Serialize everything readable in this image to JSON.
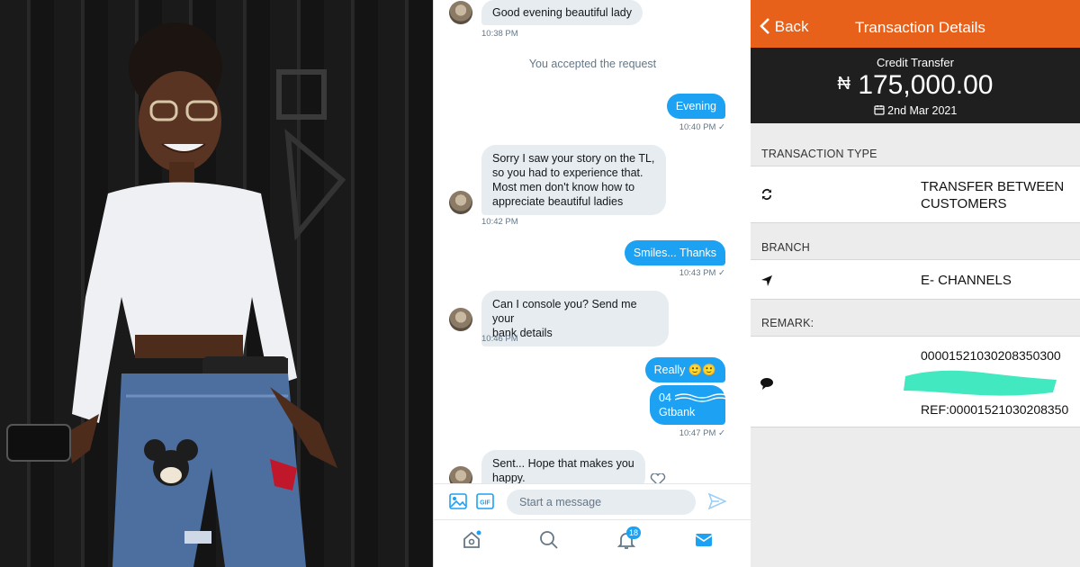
{
  "chat": {
    "messages": [
      {
        "dir": "in",
        "text": "Good evening beautiful lady",
        "time": "10:38 PM"
      },
      {
        "dir": "system",
        "text": "You accepted the request"
      },
      {
        "dir": "out",
        "text": "Evening",
        "time": "10:40 PM"
      },
      {
        "dir": "in",
        "lines": [
          "Sorry I saw your story on the TL,",
          "so you had to experience that.",
          "Most men don't know how to",
          "appreciate beautiful ladies"
        ],
        "time": "10:42 PM"
      },
      {
        "dir": "out",
        "text": "Smiles... Thanks",
        "time": "10:43 PM"
      },
      {
        "dir": "in",
        "lines": [
          "Can I console you? Send me your",
          "bank details"
        ],
        "time": "10:46 PM"
      },
      {
        "dir": "out",
        "text": "Really 🙂🙂"
      },
      {
        "dir": "out",
        "lines": [
          "04",
          "Gtbank"
        ],
        "time": "10:47 PM"
      },
      {
        "dir": "in",
        "lines": [
          "Sent... Hope that makes you",
          "happy."
        ]
      }
    ],
    "compose_placeholder": "Start a message",
    "notification_count": "18"
  },
  "transaction": {
    "back_label": "Back",
    "title": "Transaction Details",
    "type_label": "Credit Transfer",
    "currency_symbol": "₦",
    "amount": "175,000.00",
    "date": "2nd Mar 2021",
    "sections": {
      "transaction_type": "TRANSACTION TYPE",
      "branch": "BRANCH",
      "remark": "REMARK:"
    },
    "transaction_type_lines": [
      "TRANSFER BETWEEN",
      "CUSTOMERS"
    ],
    "branch_value": "E- CHANNELS",
    "remark_line1": "00001521030208350300",
    "remark_line2": "REF:00001521030208350"
  },
  "colors": {
    "header_orange": "#e8611a",
    "amount_bg": "#1f1f1f",
    "twitter_blue": "#1da1f2",
    "bubble_grey": "#e6ecf0",
    "redaction": "#2ee6b8"
  },
  "icons": [
    "image-icon",
    "gif-icon",
    "send-icon",
    "home-icon",
    "search-icon",
    "notifications-icon",
    "messages-icon",
    "chevron-left-icon",
    "calendar-icon",
    "refresh-icon",
    "location-arrow-icon",
    "comment-icon",
    "heart-icon"
  ]
}
